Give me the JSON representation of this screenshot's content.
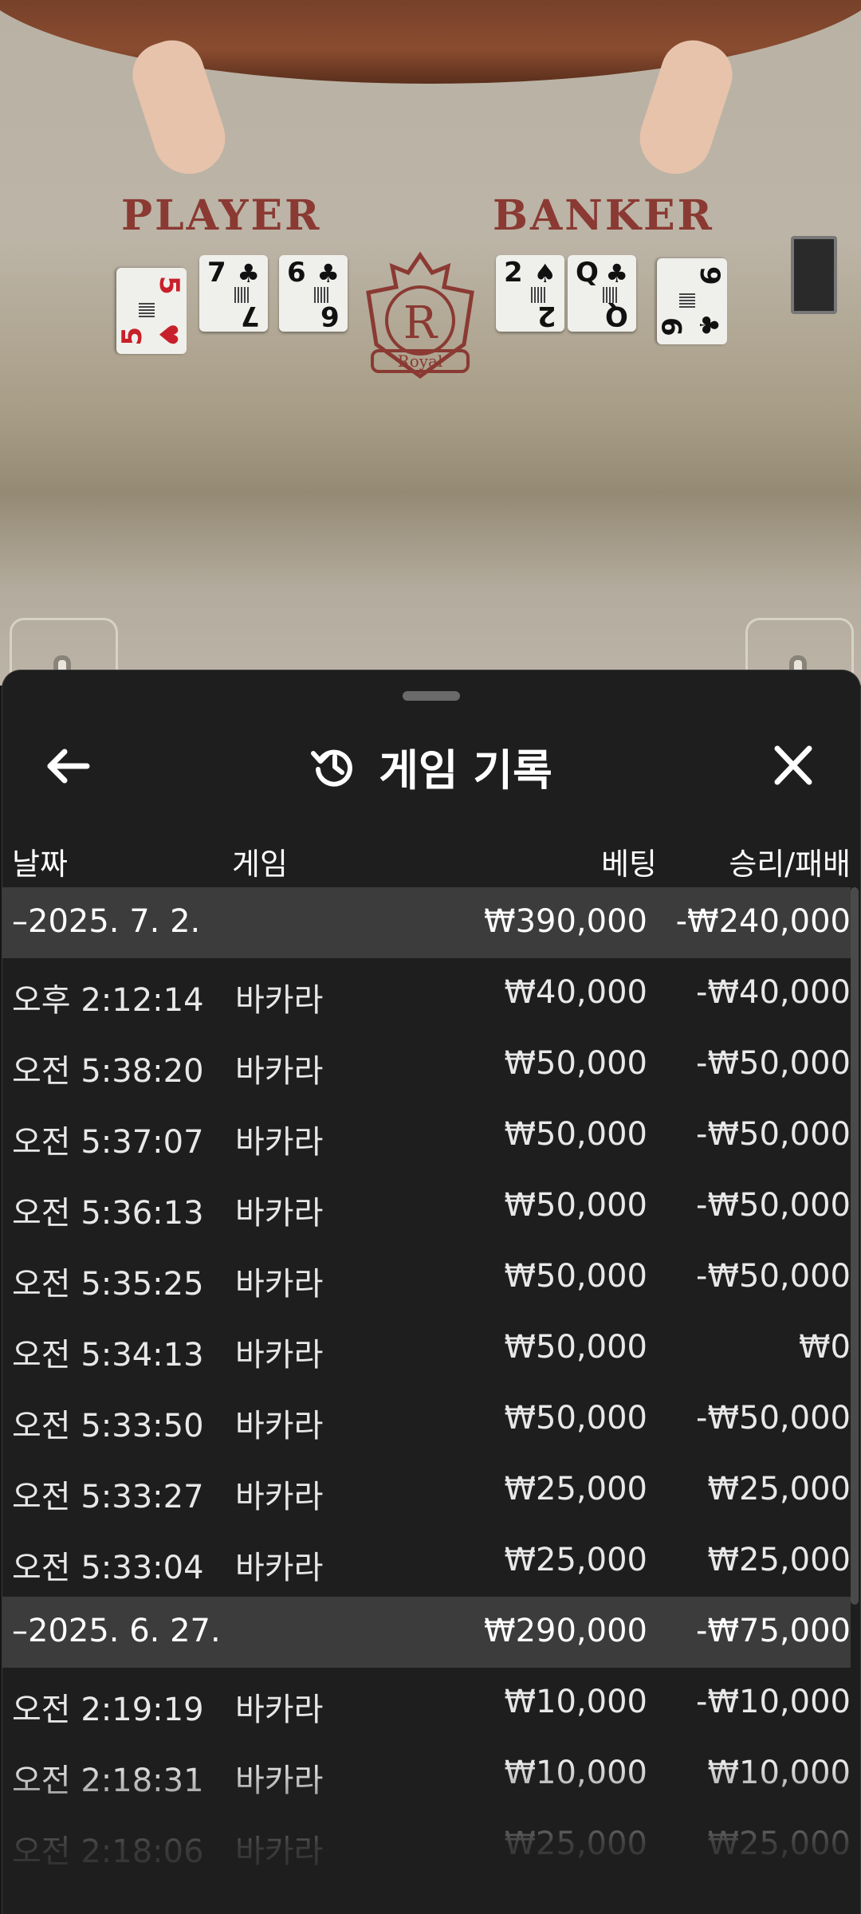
{
  "table": {
    "player_label": "PLAYER",
    "banker_label": "BANKER",
    "crest_letter": "R",
    "crest_text": "Royal"
  },
  "sheet": {
    "title": "게임 기록",
    "icons": {
      "back": "arrow-left-icon",
      "history": "history-icon",
      "close": "close-icon"
    },
    "columns": {
      "date": "날짜",
      "game": "게임",
      "bet": "베팅",
      "result": "승리/패배"
    },
    "days": [
      {
        "date": "–2025. 7. 2.",
        "bet": "₩390,000",
        "result": "-₩240,000",
        "rows": [
          {
            "time": "오후 2:12:14",
            "game": "바카라",
            "bet": "₩40,000",
            "result": "-₩40,000"
          },
          {
            "time": "오전 5:38:20",
            "game": "바카라",
            "bet": "₩50,000",
            "result": "-₩50,000"
          },
          {
            "time": "오전 5:37:07",
            "game": "바카라",
            "bet": "₩50,000",
            "result": "-₩50,000"
          },
          {
            "time": "오전 5:36:13",
            "game": "바카라",
            "bet": "₩50,000",
            "result": "-₩50,000"
          },
          {
            "time": "오전 5:35:25",
            "game": "바카라",
            "bet": "₩50,000",
            "result": "-₩50,000"
          },
          {
            "time": "오전 5:34:13",
            "game": "바카라",
            "bet": "₩50,000",
            "result": "₩0"
          },
          {
            "time": "오전 5:33:50",
            "game": "바카라",
            "bet": "₩50,000",
            "result": "-₩50,000"
          },
          {
            "time": "오전 5:33:27",
            "game": "바카라",
            "bet": "₩25,000",
            "result": "₩25,000"
          },
          {
            "time": "오전 5:33:04",
            "game": "바카라",
            "bet": "₩25,000",
            "result": "₩25,000"
          }
        ]
      },
      {
        "date": "–2025. 6. 27.",
        "bet": "₩290,000",
        "result": "-₩75,000",
        "rows": [
          {
            "time": "오전 2:19:19",
            "game": "바카라",
            "bet": "₩10,000",
            "result": "-₩10,000"
          },
          {
            "time": "오전 2:18:31",
            "game": "바카라",
            "bet": "₩10,000",
            "result": "₩10,000"
          },
          {
            "time": "오전 2:18:06",
            "game": "바카라",
            "bet": "₩25,000",
            "result": "₩25,000"
          }
        ]
      }
    ]
  }
}
